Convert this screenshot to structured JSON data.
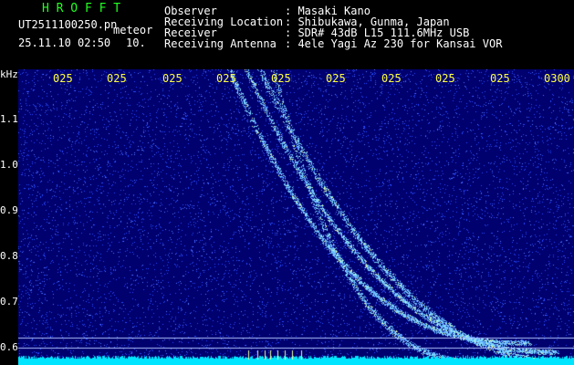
{
  "header": {
    "title": "H R O F F T",
    "filename": "UT2511100250.pn",
    "tag": "meteor",
    "datetime": "25.11.10 02:50",
    "counter": "10.",
    "info": [
      {
        "label": "Observer",
        "value": ": Masaki Kano"
      },
      {
        "label": "Receiving Location",
        "value": ": Shibukawa, Gunma, Japan"
      },
      {
        "label": "Receiver",
        "value": ": SDR# 43dB L15 111.6MHz USB"
      },
      {
        "label": "Receiving Antenna",
        "value": ": 4ele Yagi Az 230 for Kansai VOR"
      }
    ]
  },
  "axes": {
    "y_unit": "kHz",
    "y_ticks": [
      "1.1",
      "1.0",
      "0.9",
      "0.8",
      "0.7",
      "0.6"
    ],
    "x_ticks": [
      "025",
      "025",
      "025",
      "025",
      "025",
      "025",
      "025",
      "025",
      "025",
      "0300"
    ]
  },
  "colors": {
    "background": "#00006e",
    "noise": "#2a4cff",
    "signal": "#7fdcff",
    "hot": "#eaff9a",
    "baseline": "#00e5ff"
  }
}
